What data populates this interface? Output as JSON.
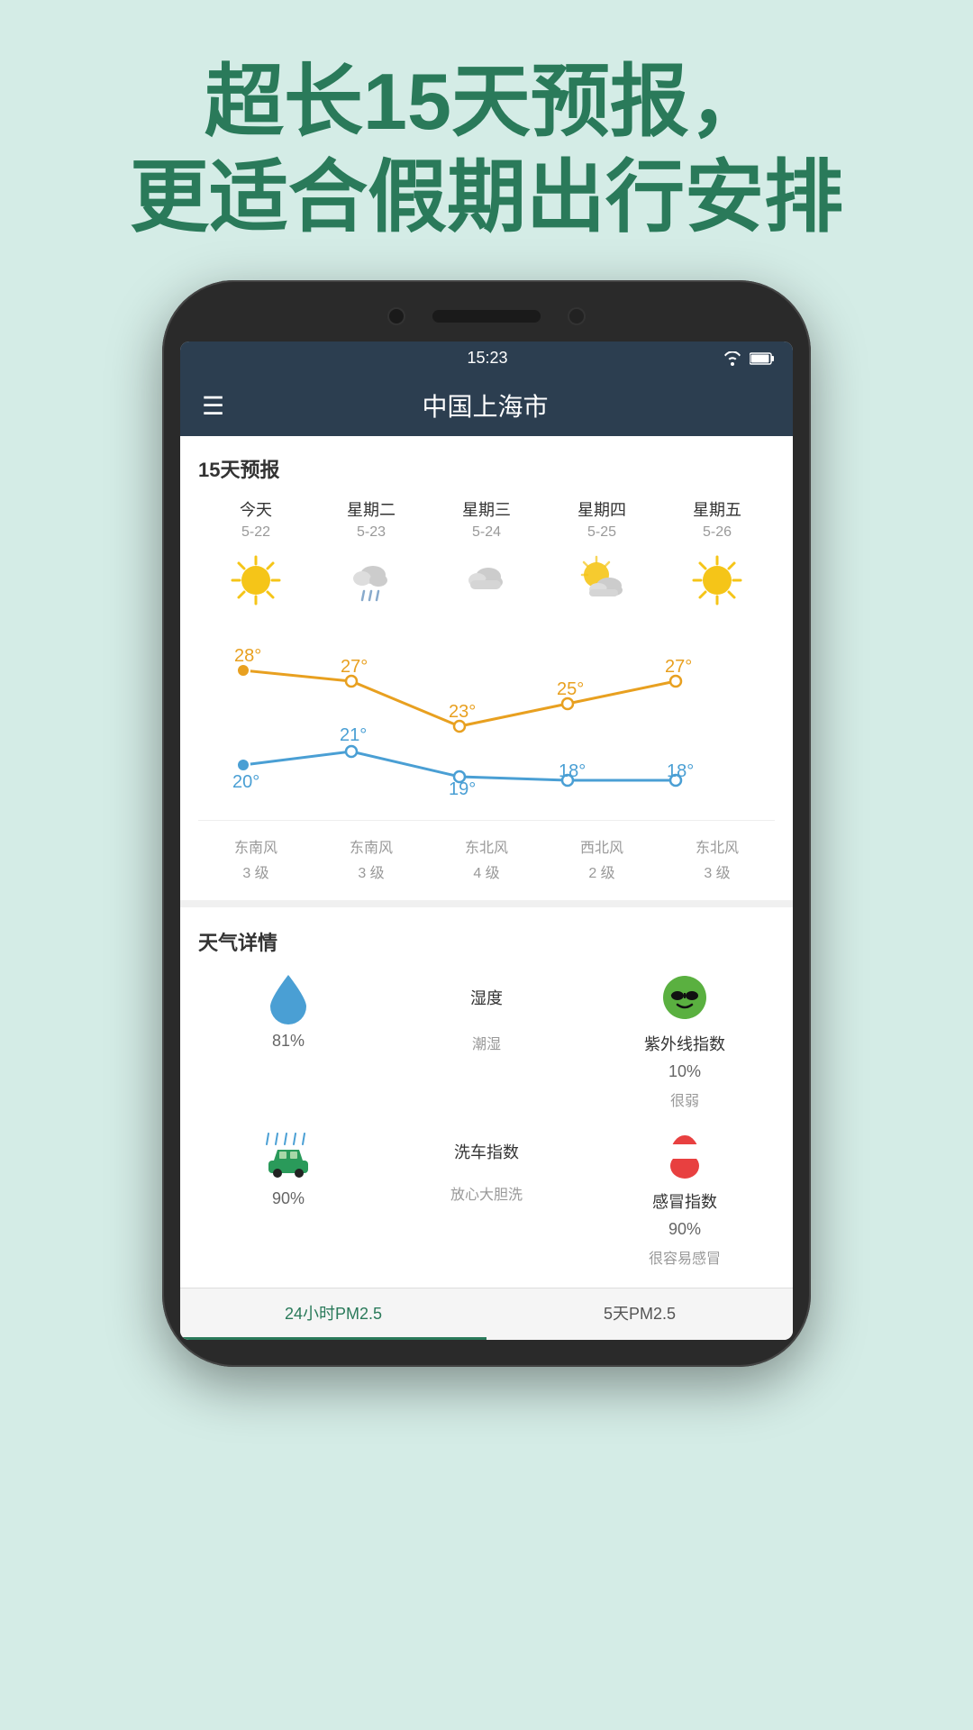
{
  "header": {
    "line1": "超长15天预报，",
    "line2": "更适合假期出行安排"
  },
  "phone": {
    "statusBar": {
      "time": "15:23",
      "wifi": "WiFi",
      "battery": "Battery"
    },
    "navbar": {
      "menu": "☰",
      "city": "中国上海市"
    },
    "forecast": {
      "sectionTitle": "15天预报",
      "days": [
        {
          "label": "今天",
          "date": "5-22",
          "icon": "sun",
          "high": "28°",
          "low": "20°",
          "wind1": "东南风",
          "wind2": "3 级"
        },
        {
          "label": "星期二",
          "date": "5-23",
          "icon": "cloud-rain",
          "high": "27°",
          "low": "21°",
          "wind1": "东南风",
          "wind2": "3 级"
        },
        {
          "label": "星期三",
          "date": "5-24",
          "icon": "cloud",
          "high": "23°",
          "low": "19°",
          "wind1": "东北风",
          "wind2": "4 级"
        },
        {
          "label": "星期四",
          "date": "5-25",
          "icon": "partly-cloudy",
          "high": "25°",
          "low": "18°",
          "wind1": "西北风",
          "wind2": "2 级"
        },
        {
          "label": "星期五",
          "date": "5-26",
          "icon": "sun",
          "high": "27°",
          "low": "18°",
          "wind1": "东北风",
          "wind2": "3 级"
        }
      ]
    },
    "details": {
      "sectionTitle": "天气详情",
      "items": [
        {
          "icon": "drop",
          "value": "81%",
          "label": "",
          "desc": ""
        },
        {
          "icon": "",
          "value": "湿度",
          "label": "",
          "desc": "潮湿"
        },
        {
          "icon": "emoji-cool",
          "value": "10%",
          "label": "紫外线指数",
          "desc": "很弱"
        },
        {
          "icon": "car-wash",
          "value": "90%",
          "label": "洗车指数",
          "desc": "放心大胆洗"
        },
        {
          "icon": "",
          "value": "",
          "label": "",
          "desc": ""
        },
        {
          "icon": "pill",
          "value": "90%",
          "label": "感冒指数",
          "desc": "很容易感冒"
        }
      ],
      "humidity_label": "湿度",
      "humidity_value": "81%",
      "humidity_desc": "潮湿",
      "uv_label": "紫外线指数",
      "uv_value": "10%",
      "uv_desc": "很弱",
      "carwash_label": "洗车指数",
      "carwash_value": "90%",
      "carwash_desc": "放心大胆洗",
      "cold_label": "感冒指数",
      "cold_value": "90%",
      "cold_desc": "很容易感冒"
    },
    "bottomTabs": {
      "tab1": "24小时PM2.5",
      "tab2": "5天PM2.5"
    }
  }
}
